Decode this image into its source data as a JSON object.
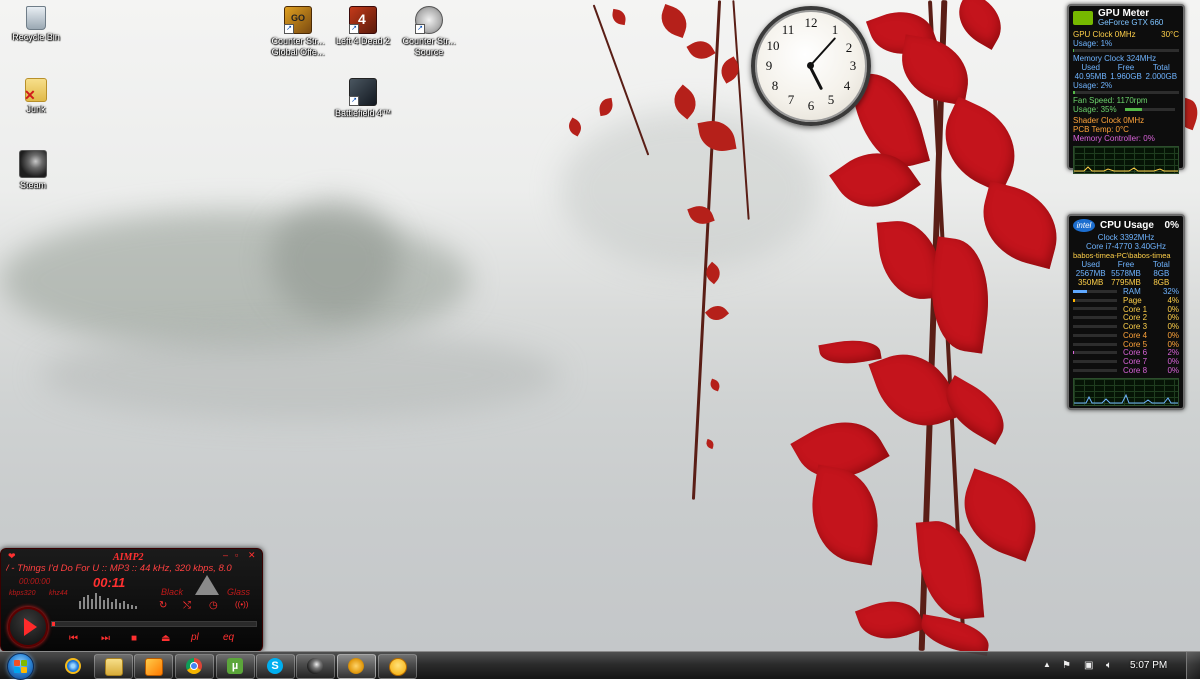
{
  "desktop_icons": [
    {
      "label": "Recycle Bin",
      "icon": "recycle-bin-icon"
    },
    {
      "label": "Junk",
      "icon": "folder-icon"
    },
    {
      "label": "Steam",
      "icon": "steam-icon"
    },
    {
      "label": "Counter Str...\nGlobal Offe...",
      "icon": "csgo-icon"
    },
    {
      "label": "Left 4 Dead 2",
      "icon": "left4dead2-icon"
    },
    {
      "label": "Counter Str...\nSource",
      "icon": "css-icon"
    },
    {
      "label": "Battlefield 4™",
      "icon": "battlefield4-icon"
    }
  ],
  "clock_gadget": {
    "numbers": [
      "12",
      "1",
      "2",
      "3",
      "4",
      "5",
      "6",
      "7",
      "8",
      "9",
      "10",
      "11"
    ],
    "time_shown": "5:07"
  },
  "gpu_meter": {
    "title": "GPU Meter",
    "gpu_name": "GeForce GTX 660",
    "gpu_clock": "GPU Clock 0MHz",
    "temp": "30°C",
    "usage": "Usage: 1%",
    "usage_pct": 1,
    "mem_clock": "Memory Clock 324MHz",
    "mem_headers": [
      "Used",
      "Free",
      "Total"
    ],
    "mem_values": [
      "40.95MB",
      "1.960GB",
      "2.000GB"
    ],
    "mem_usage": "Usage: 2%",
    "mem_usage_pct": 2,
    "fan": "Fan Speed: 1170rpm",
    "fan_usage": "Usage: 35%",
    "fan_usage_pct": 35,
    "shader": "Shader Clock 0MHz",
    "pcb": "PCB Temp: 0°C",
    "mem_ctrl": "Memory Controller: 0%"
  },
  "cpu_meter": {
    "brand": "intel",
    "title": "CPU Usage",
    "pct": "0%",
    "clock": "Clock 3392MHz",
    "model": "Core i7-4770 3.40GHz",
    "host": "babos-timea-PC\\babos-timea",
    "headers": [
      "Used",
      "Free",
      "Total"
    ],
    "ram_row": [
      "2567MB",
      "5578MB",
      "8GB"
    ],
    "page_row": [
      "350MB",
      "7795MB",
      "8GB"
    ],
    "rows": [
      {
        "label": "RAM",
        "value": "32%",
        "pct": 32
      },
      {
        "label": "Page",
        "value": "4%",
        "pct": 4
      },
      {
        "label": "Core 1",
        "value": "0%",
        "pct": 0
      },
      {
        "label": "Core 2",
        "value": "0%",
        "pct": 0
      },
      {
        "label": "Core 3",
        "value": "0%",
        "pct": 0
      },
      {
        "label": "Core 4",
        "value": "0%",
        "pct": 0
      },
      {
        "label": "Core 5",
        "value": "0%",
        "pct": 0
      },
      {
        "label": "Core 6",
        "value": "2%",
        "pct": 2
      },
      {
        "label": "Core 7",
        "value": "0%",
        "pct": 0
      },
      {
        "label": "Core 8",
        "value": "0%",
        "pct": 0
      }
    ]
  },
  "aimp": {
    "brand": "AIMP2",
    "marquee": "/ - Things I'd Do For U :: MP3 :: 44 kHz, 320 kbps, 8.0",
    "elapsed": "00:00:00",
    "time": "00:11",
    "kbps": "kbps320",
    "khz": "khz44",
    "skin": "Black",
    "skin2": "Glass",
    "btn_pl": "pl",
    "btn_eq": "eq"
  },
  "taskbar": {
    "pinned": [
      "internet-explorer-icon",
      "windows-explorer-icon",
      "media-player-icon",
      "chrome-icon",
      "utorrent-icon",
      "skype-icon",
      "steam-icon",
      "aimp-icon",
      "messenger-icon"
    ],
    "time": "5:07 PM"
  },
  "colors": {
    "leaf_red": "#c4141c",
    "gadget_bg": "#0d0d0d",
    "aimp_red": "#e02020"
  }
}
